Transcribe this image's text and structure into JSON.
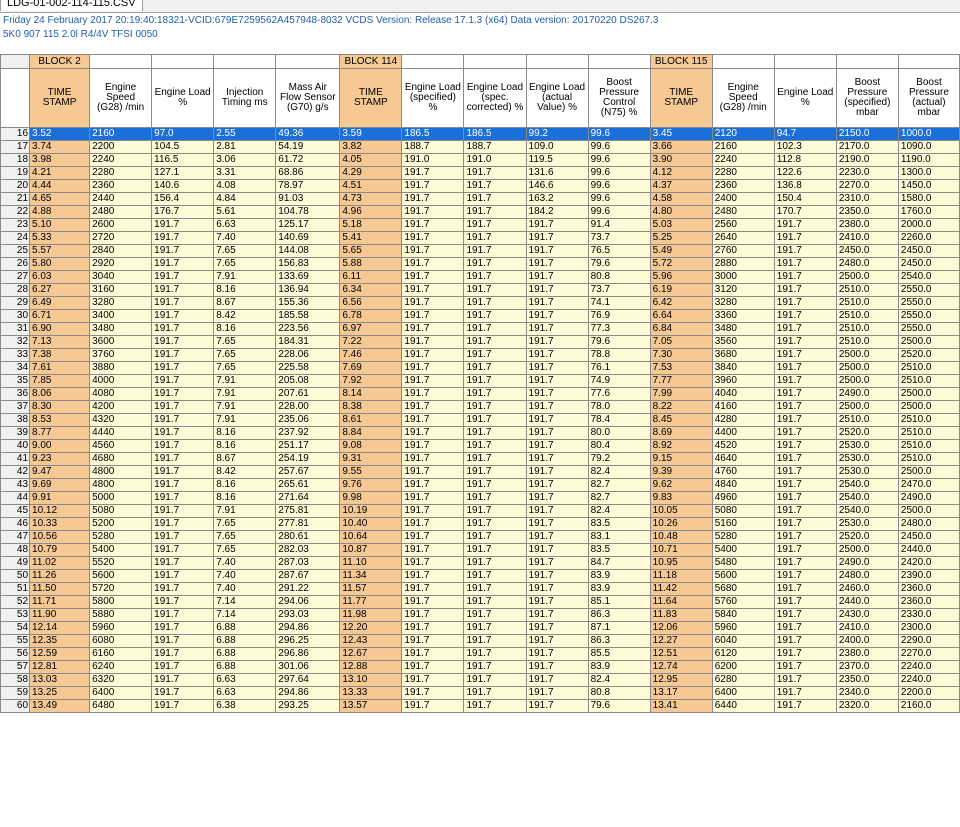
{
  "window": {
    "tab_label": "LDG-01-002-114-115.CSV"
  },
  "header": {
    "line1": "Friday 24 February 2017 20:19:40:18321-VCID:679E7259562A457948-8032 VCDS Version: Release 17.1.3 (x64) Data version: 20170220 DS267.3",
    "line2": "5K0 907 115  2.0l R4/4V TFSI     0050"
  },
  "blocks": [
    {
      "label": "BLOCK 2"
    },
    {
      "label": "BLOCK 114"
    },
    {
      "label": "BLOCK 115"
    }
  ],
  "columns": [
    "TIME STAMP",
    "Engine Speed (G28) /min",
    "Engine Load %",
    "Injection Timing ms",
    "Mass Air Flow Sensor (G70) g/s",
    "TIME STAMP",
    "Engine Load (specified) %",
    "Engine Load (spec. corrected) %",
    "Engine Load (actual Value) %",
    "Boost Pressure Control (N75) %",
    "TIME STAMP",
    "Engine Speed (G28) /min",
    "Engine Load %",
    "Boost Pressure (specified) mbar",
    "Boost Pressure (actual) mbar"
  ],
  "selected_row": 16,
  "rows": [
    {
      "n": "16",
      "c": [
        "3.52",
        "2160",
        "97.0",
        "2.55",
        "49.36",
        "3.59",
        "186.5",
        "186.5",
        "99.2",
        "99.6",
        "3.45",
        "2120",
        "94.7",
        "2150.0",
        "1000.0"
      ]
    },
    {
      "n": "17",
      "c": [
        "3.74",
        "2200",
        "104.5",
        "2.81",
        "54.19",
        "3.82",
        "188.7",
        "188.7",
        "109.0",
        "99.6",
        "3.66",
        "2160",
        "102.3",
        "2170.0",
        "1090.0"
      ]
    },
    {
      "n": "18",
      "c": [
        "3.98",
        "2240",
        "116.5",
        "3.06",
        "61.72",
        "4.05",
        "191.0",
        "191.0",
        "119.5",
        "99.6",
        "3.90",
        "2240",
        "112.8",
        "2190.0",
        "1190.0"
      ]
    },
    {
      "n": "19",
      "c": [
        "4.21",
        "2280",
        "127.1",
        "3.31",
        "68.86",
        "4.29",
        "191.7",
        "191.7",
        "131.6",
        "99.6",
        "4.12",
        "2280",
        "122.6",
        "2230.0",
        "1300.0"
      ]
    },
    {
      "n": "20",
      "c": [
        "4.44",
        "2360",
        "140.6",
        "4.08",
        "78.97",
        "4.51",
        "191.7",
        "191.7",
        "146.6",
        "99.6",
        "4.37",
        "2360",
        "136.8",
        "2270.0",
        "1450.0"
      ]
    },
    {
      "n": "21",
      "c": [
        "4.65",
        "2440",
        "156.4",
        "4.84",
        "91.03",
        "4.73",
        "191.7",
        "191.7",
        "163.2",
        "99.6",
        "4.58",
        "2400",
        "150.4",
        "2310.0",
        "1580.0"
      ]
    },
    {
      "n": "22",
      "c": [
        "4.88",
        "2480",
        "176.7",
        "5.61",
        "104.78",
        "4.96",
        "191.7",
        "191.7",
        "184.2",
        "99.6",
        "4.80",
        "2480",
        "170.7",
        "2350.0",
        "1760.0"
      ]
    },
    {
      "n": "23",
      "c": [
        "5.10",
        "2600",
        "191.7",
        "6.63",
        "125.17",
        "5.18",
        "191.7",
        "191.7",
        "191.7",
        "91.4",
        "5.03",
        "2560",
        "191.7",
        "2380.0",
        "2000.0"
      ]
    },
    {
      "n": "24",
      "c": [
        "5.33",
        "2720",
        "191.7",
        "7.40",
        "140.69",
        "5.41",
        "191.7",
        "191.7",
        "191.7",
        "73.7",
        "5.25",
        "2640",
        "191.7",
        "2410.0",
        "2260.0"
      ]
    },
    {
      "n": "25",
      "c": [
        "5.57",
        "2840",
        "191.7",
        "7.65",
        "144.08",
        "5.65",
        "191.7",
        "191.7",
        "191.7",
        "76.5",
        "5.49",
        "2760",
        "191.7",
        "2450.0",
        "2450.0"
      ]
    },
    {
      "n": "26",
      "c": [
        "5.80",
        "2920",
        "191.7",
        "7.65",
        "156.83",
        "5.88",
        "191.7",
        "191.7",
        "191.7",
        "79.6",
        "5.72",
        "2880",
        "191.7",
        "2480.0",
        "2450.0"
      ]
    },
    {
      "n": "27",
      "c": [
        "6.03",
        "3040",
        "191.7",
        "7.91",
        "133.69",
        "6.11",
        "191.7",
        "191.7",
        "191.7",
        "80.8",
        "5.96",
        "3000",
        "191.7",
        "2500.0",
        "2540.0"
      ]
    },
    {
      "n": "28",
      "c": [
        "6.27",
        "3160",
        "191.7",
        "8.16",
        "136.94",
        "6.34",
        "191.7",
        "191.7",
        "191.7",
        "73.7",
        "6.19",
        "3120",
        "191.7",
        "2510.0",
        "2550.0"
      ]
    },
    {
      "n": "29",
      "c": [
        "6.49",
        "3280",
        "191.7",
        "8.67",
        "155.36",
        "6.56",
        "191.7",
        "191.7",
        "191.7",
        "74.1",
        "6.42",
        "3280",
        "191.7",
        "2510.0",
        "2550.0"
      ]
    },
    {
      "n": "30",
      "c": [
        "6.71",
        "3400",
        "191.7",
        "8.42",
        "185.58",
        "6.78",
        "191.7",
        "191.7",
        "191.7",
        "76.9",
        "6.64",
        "3360",
        "191.7",
        "2510.0",
        "2550.0"
      ]
    },
    {
      "n": "31",
      "c": [
        "6.90",
        "3480",
        "191.7",
        "8.16",
        "223.56",
        "6.97",
        "191.7",
        "191.7",
        "191.7",
        "77.3",
        "6.84",
        "3480",
        "191.7",
        "2510.0",
        "2550.0"
      ]
    },
    {
      "n": "32",
      "c": [
        "7.13",
        "3600",
        "191.7",
        "7.65",
        "184.31",
        "7.22",
        "191.7",
        "191.7",
        "191.7",
        "79.6",
        "7.05",
        "3560",
        "191.7",
        "2510.0",
        "2500.0"
      ]
    },
    {
      "n": "33",
      "c": [
        "7.38",
        "3760",
        "191.7",
        "7.65",
        "228.06",
        "7.46",
        "191.7",
        "191.7",
        "191.7",
        "78.8",
        "7.30",
        "3680",
        "191.7",
        "2500.0",
        "2520.0"
      ]
    },
    {
      "n": "34",
      "c": [
        "7.61",
        "3880",
        "191.7",
        "7.65",
        "225.58",
        "7.69",
        "191.7",
        "191.7",
        "191.7",
        "76.1",
        "7.53",
        "3840",
        "191.7",
        "2500.0",
        "2510.0"
      ]
    },
    {
      "n": "35",
      "c": [
        "7.85",
        "4000",
        "191.7",
        "7.91",
        "205.08",
        "7.92",
        "191.7",
        "191.7",
        "191.7",
        "74.9",
        "7.77",
        "3960",
        "191.7",
        "2500.0",
        "2510.0"
      ]
    },
    {
      "n": "36",
      "c": [
        "8.06",
        "4080",
        "191.7",
        "7.91",
        "207.61",
        "8.14",
        "191.7",
        "191.7",
        "191.7",
        "77.6",
        "7.99",
        "4040",
        "191.7",
        "2490.0",
        "2500.0"
      ]
    },
    {
      "n": "37",
      "c": [
        "8.30",
        "4200",
        "191.7",
        "7.91",
        "228.00",
        "8.38",
        "191.7",
        "191.7",
        "191.7",
        "78.0",
        "8.22",
        "4160",
        "191.7",
        "2500.0",
        "2500.0"
      ]
    },
    {
      "n": "38",
      "c": [
        "8.53",
        "4320",
        "191.7",
        "7.91",
        "235.06",
        "8.61",
        "191.7",
        "191.7",
        "191.7",
        "78.4",
        "8.45",
        "4280",
        "191.7",
        "2510.0",
        "2510.0"
      ]
    },
    {
      "n": "39",
      "c": [
        "8.77",
        "4440",
        "191.7",
        "8.16",
        "237.92",
        "8.84",
        "191.7",
        "191.7",
        "191.7",
        "80.0",
        "8.69",
        "4400",
        "191.7",
        "2520.0",
        "2510.0"
      ]
    },
    {
      "n": "40",
      "c": [
        "9.00",
        "4560",
        "191.7",
        "8.16",
        "251.17",
        "9.08",
        "191.7",
        "191.7",
        "191.7",
        "80.4",
        "8.92",
        "4520",
        "191.7",
        "2530.0",
        "2510.0"
      ]
    },
    {
      "n": "41",
      "c": [
        "9.23",
        "4680",
        "191.7",
        "8.67",
        "254.19",
        "9.31",
        "191.7",
        "191.7",
        "191.7",
        "79.2",
        "9.15",
        "4640",
        "191.7",
        "2530.0",
        "2510.0"
      ]
    },
    {
      "n": "42",
      "c": [
        "9.47",
        "4800",
        "191.7",
        "8.42",
        "257.67",
        "9.55",
        "191.7",
        "191.7",
        "191.7",
        "82.4",
        "9.39",
        "4760",
        "191.7",
        "2530.0",
        "2500.0"
      ]
    },
    {
      "n": "43",
      "c": [
        "9.69",
        "4800",
        "191.7",
        "8.16",
        "265.61",
        "9.76",
        "191.7",
        "191.7",
        "191.7",
        "82.7",
        "9.62",
        "4840",
        "191.7",
        "2540.0",
        "2470.0"
      ]
    },
    {
      "n": "44",
      "c": [
        "9.91",
        "5000",
        "191.7",
        "8.16",
        "271.64",
        "9.98",
        "191.7",
        "191.7",
        "191.7",
        "82.7",
        "9.83",
        "4960",
        "191.7",
        "2540.0",
        "2490.0"
      ]
    },
    {
      "n": "45",
      "c": [
        "10.12",
        "5080",
        "191.7",
        "7.91",
        "275.81",
        "10.19",
        "191.7",
        "191.7",
        "191.7",
        "82.4",
        "10.05",
        "5080",
        "191.7",
        "2540.0",
        "2500.0"
      ]
    },
    {
      "n": "46",
      "c": [
        "10.33",
        "5200",
        "191.7",
        "7.65",
        "277.81",
        "10.40",
        "191.7",
        "191.7",
        "191.7",
        "83.5",
        "10.26",
        "5160",
        "191.7",
        "2530.0",
        "2480.0"
      ]
    },
    {
      "n": "47",
      "c": [
        "10.56",
        "5280",
        "191.7",
        "7.65",
        "280.61",
        "10.64",
        "191.7",
        "191.7",
        "191.7",
        "83.1",
        "10.48",
        "5280",
        "191.7",
        "2520.0",
        "2450.0"
      ]
    },
    {
      "n": "48",
      "c": [
        "10.79",
        "5400",
        "191.7",
        "7.65",
        "282.03",
        "10.87",
        "191.7",
        "191.7",
        "191.7",
        "83.5",
        "10.71",
        "5400",
        "191.7",
        "2500.0",
        "2440.0"
      ]
    },
    {
      "n": "49",
      "c": [
        "11.02",
        "5520",
        "191.7",
        "7.40",
        "287.03",
        "11.10",
        "191.7",
        "191.7",
        "191.7",
        "84.7",
        "10.95",
        "5480",
        "191.7",
        "2490.0",
        "2420.0"
      ]
    },
    {
      "n": "50",
      "c": [
        "11.26",
        "5600",
        "191.7",
        "7.40",
        "287.67",
        "11.34",
        "191.7",
        "191.7",
        "191.7",
        "83.9",
        "11.18",
        "5600",
        "191.7",
        "2480.0",
        "2390.0"
      ]
    },
    {
      "n": "51",
      "c": [
        "11.50",
        "5720",
        "191.7",
        "7.40",
        "291.22",
        "11.57",
        "191.7",
        "191.7",
        "191.7",
        "83.9",
        "11.42",
        "5680",
        "191.7",
        "2460.0",
        "2360.0"
      ]
    },
    {
      "n": "52",
      "c": [
        "11.71",
        "5800",
        "191.7",
        "7.14",
        "294.06",
        "11.77",
        "191.7",
        "191.7",
        "191.7",
        "85.1",
        "11.64",
        "5760",
        "191.7",
        "2440.0",
        "2360.0"
      ]
    },
    {
      "n": "53",
      "c": [
        "11.90",
        "5880",
        "191.7",
        "7.14",
        "293.03",
        "11.98",
        "191.7",
        "191.7",
        "191.7",
        "86.3",
        "11.83",
        "5840",
        "191.7",
        "2430.0",
        "2330.0"
      ]
    },
    {
      "n": "54",
      "c": [
        "12.14",
        "5960",
        "191.7",
        "6.88",
        "294.86",
        "12.20",
        "191.7",
        "191.7",
        "191.7",
        "87.1",
        "12.06",
        "5960",
        "191.7",
        "2410.0",
        "2300.0"
      ]
    },
    {
      "n": "55",
      "c": [
        "12.35",
        "6080",
        "191.7",
        "6.88",
        "296.25",
        "12.43",
        "191.7",
        "191.7",
        "191.7",
        "86.3",
        "12.27",
        "6040",
        "191.7",
        "2400.0",
        "2290.0"
      ]
    },
    {
      "n": "56",
      "c": [
        "12.59",
        "6160",
        "191.7",
        "6.88",
        "296.86",
        "12.67",
        "191.7",
        "191.7",
        "191.7",
        "85.5",
        "12.51",
        "6120",
        "191.7",
        "2380.0",
        "2270.0"
      ]
    },
    {
      "n": "57",
      "c": [
        "12.81",
        "6240",
        "191.7",
        "6.88",
        "301.06",
        "12.88",
        "191.7",
        "191.7",
        "191.7",
        "83.9",
        "12.74",
        "6200",
        "191.7",
        "2370.0",
        "2240.0"
      ]
    },
    {
      "n": "58",
      "c": [
        "13.03",
        "6320",
        "191.7",
        "6.63",
        "297.64",
        "13.10",
        "191.7",
        "191.7",
        "191.7",
        "82.4",
        "12.95",
        "6280",
        "191.7",
        "2350.0",
        "2240.0"
      ]
    },
    {
      "n": "59",
      "c": [
        "13.25",
        "6400",
        "191.7",
        "6.63",
        "294.86",
        "13.33",
        "191.7",
        "191.7",
        "191.7",
        "80.8",
        "13.17",
        "6400",
        "191.7",
        "2340.0",
        "2200.0"
      ]
    },
    {
      "n": "60",
      "c": [
        "13.49",
        "6480",
        "191.7",
        "6.38",
        "293.25",
        "13.57",
        "191.7",
        "191.7",
        "191.7",
        "79.6",
        "13.41",
        "6440",
        "191.7",
        "2320.0",
        "2160.0"
      ]
    }
  ]
}
